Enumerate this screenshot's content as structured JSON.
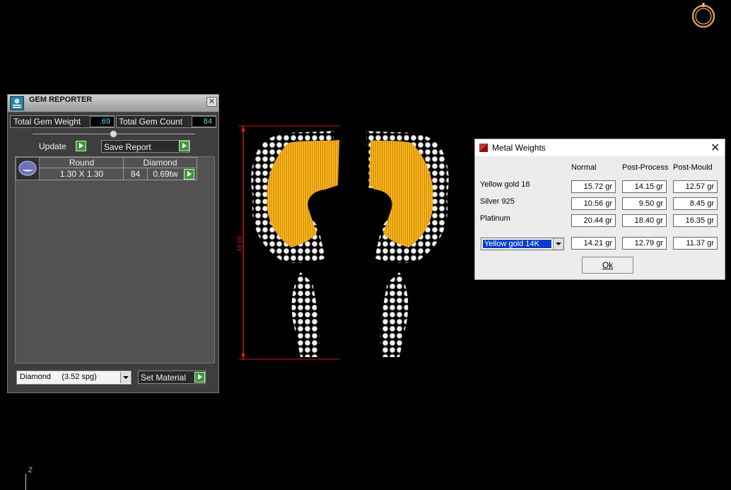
{
  "gem_reporter": {
    "title": "GEM REPORTER",
    "close_glyph": "✕",
    "total_gem_weight_label": "Total Gem Weight",
    "total_gem_weight_value": ".69",
    "total_gem_count_label": "Total Gem Count",
    "total_gem_count_value": "84",
    "update_label": "Update",
    "save_report_label": "Save Report",
    "gem_row": {
      "shape": "Round",
      "size": "1.30 X 1.30",
      "material": "Diamond",
      "count": "84",
      "weight": "0.69tw"
    },
    "material_select": "Diamond     (3.52 spg)",
    "set_material_label": "Set Material"
  },
  "metal_weights": {
    "title": "Metal Weights",
    "close_glyph": "✕",
    "columns": [
      "Normal",
      "Post-Process",
      "Post-Mould"
    ],
    "rows": [
      {
        "name": "Yellow gold 18",
        "values": [
          "15.72 gr",
          "14.15 gr",
          "12.57 gr"
        ]
      },
      {
        "name": "Silver 925",
        "values": [
          "10.56 gr",
          "9.50 gr",
          "8.45 gr"
        ]
      },
      {
        "name": "Platinum",
        "values": [
          "20.44 gr",
          "18.40 gr",
          "16.35 gr"
        ]
      }
    ],
    "selected_metal": "Yellow gold 14K",
    "selected_values": [
      "14.21 gr",
      "12.79 gr",
      "11.37 gr"
    ],
    "ok_label": "Ok"
  },
  "viewport": {
    "dimension_label": "49.00",
    "axis_label": "Z"
  },
  "colors": {
    "background": "#000000",
    "metal_gold": "#f2b01e",
    "dimension_red": "#d21a1a",
    "gem_value_cyan": "#5fdcf0",
    "go_button_green": "#3c9a35"
  },
  "icons": [
    "gem-reporter-icon",
    "close-icon",
    "go-arrow-icon",
    "gem-thumbnail-icon",
    "dropdown-arrow-icon",
    "metal-weights-icon",
    "compass-icon"
  ]
}
